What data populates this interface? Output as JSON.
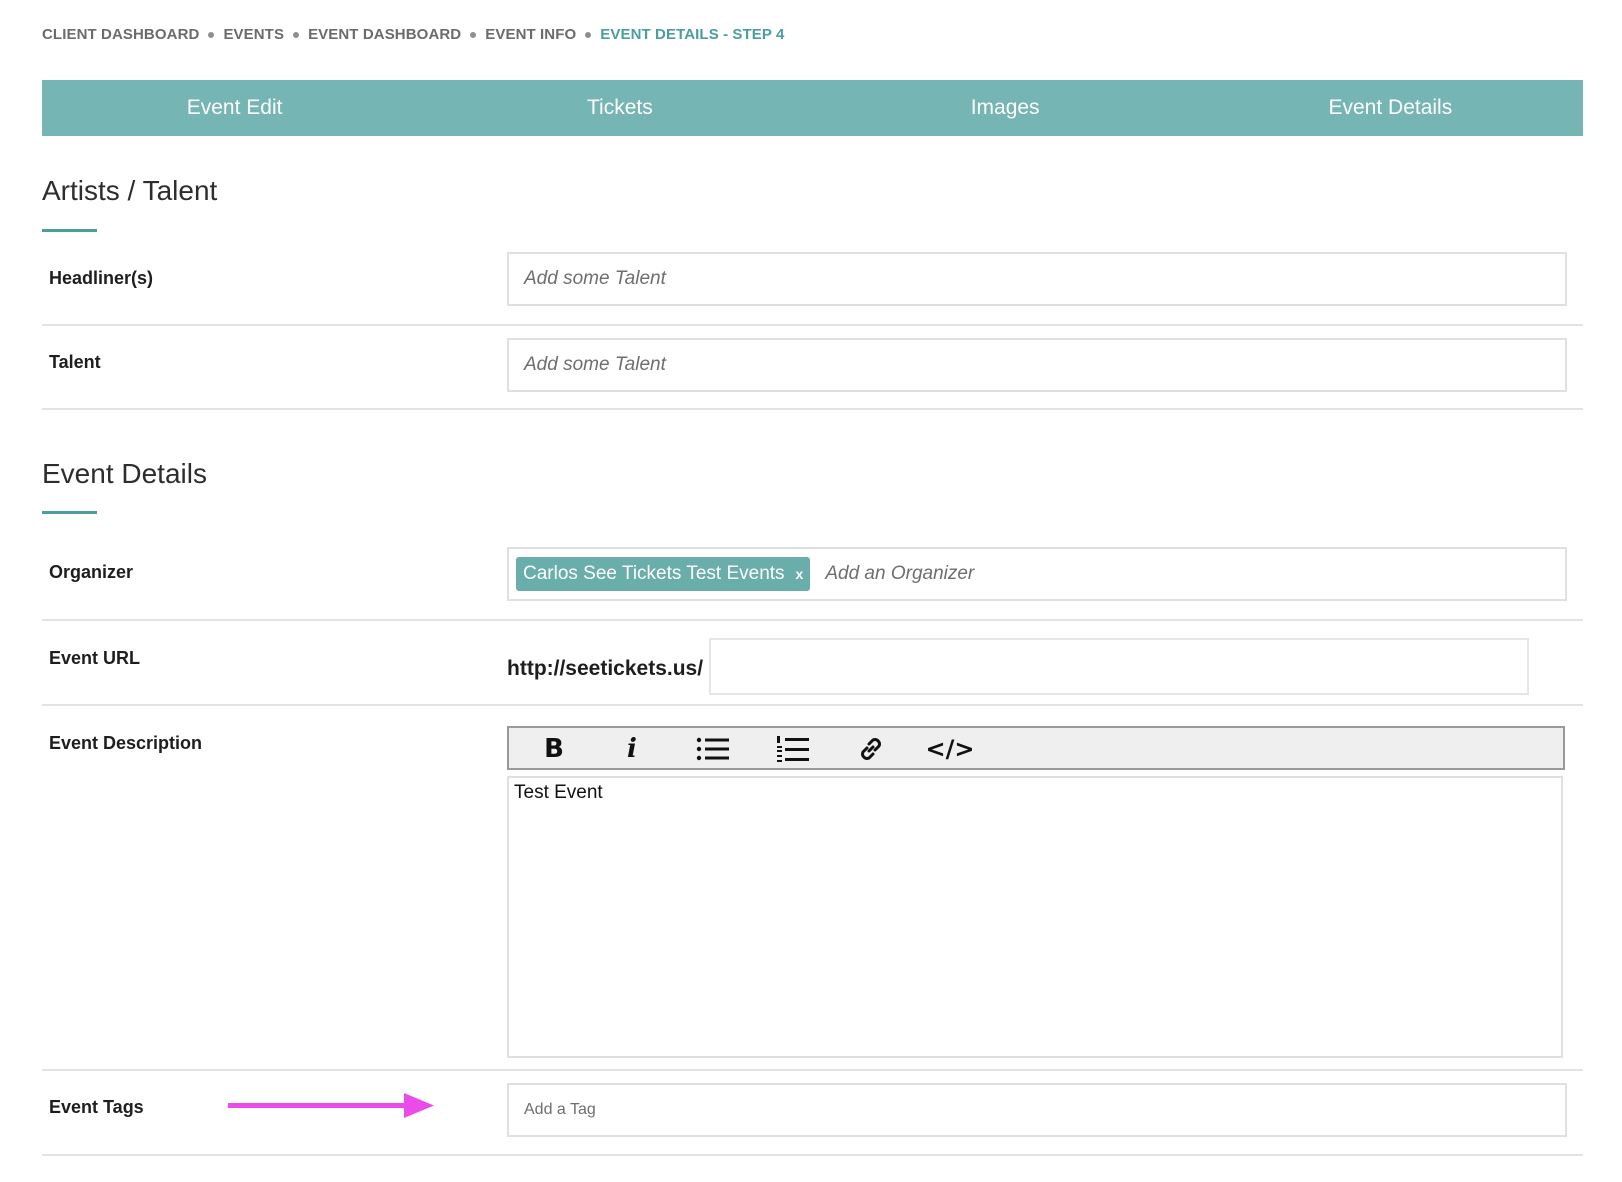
{
  "breadcrumb": {
    "items": [
      "CLIENT DASHBOARD",
      "EVENTS",
      "EVENT DASHBOARD",
      "EVENT INFO"
    ],
    "current": "EVENT DETAILS - STEP 4"
  },
  "tabs": [
    "Event Edit",
    "Tickets",
    "Images",
    "Event Details"
  ],
  "artists": {
    "title": "Artists / Talent",
    "headliners": {
      "label": "Headliner(s)",
      "placeholder": "Add some Talent"
    },
    "talent": {
      "label": "Talent",
      "placeholder": "Add some Talent"
    }
  },
  "event_details": {
    "title": "Event Details",
    "organizer": {
      "label": "Organizer",
      "chip": "Carlos See Tickets Test Events",
      "chip_remove": "x",
      "placeholder": "Add an Organizer"
    },
    "url": {
      "label": "Event URL",
      "prefix": "http://seetickets.us/",
      "value": ""
    },
    "description": {
      "label": "Event Description",
      "toolbar": {
        "bold": "B",
        "italic": "i",
        "code": "</>"
      },
      "content": "Test Event"
    },
    "tags": {
      "label": "Event Tags",
      "placeholder": "Add a Tag"
    }
  },
  "colors": {
    "accent": "#4a9e9c",
    "tab_bar": "#75b5b3",
    "annotation_arrow": "#e94ce9"
  }
}
